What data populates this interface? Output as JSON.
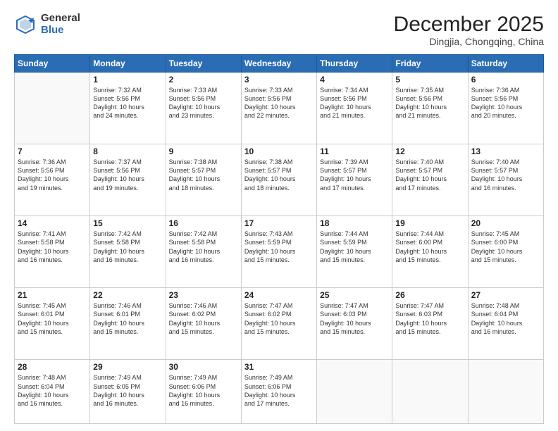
{
  "logo": {
    "general": "General",
    "blue": "Blue"
  },
  "header": {
    "month": "December 2025",
    "location": "Dingjia, Chongqing, China"
  },
  "weekdays": [
    "Sunday",
    "Monday",
    "Tuesday",
    "Wednesday",
    "Thursday",
    "Friday",
    "Saturday"
  ],
  "weeks": [
    [
      {
        "day": "",
        "info": ""
      },
      {
        "day": "1",
        "info": "Sunrise: 7:32 AM\nSunset: 5:56 PM\nDaylight: 10 hours\nand 24 minutes."
      },
      {
        "day": "2",
        "info": "Sunrise: 7:33 AM\nSunset: 5:56 PM\nDaylight: 10 hours\nand 23 minutes."
      },
      {
        "day": "3",
        "info": "Sunrise: 7:33 AM\nSunset: 5:56 PM\nDaylight: 10 hours\nand 22 minutes."
      },
      {
        "day": "4",
        "info": "Sunrise: 7:34 AM\nSunset: 5:56 PM\nDaylight: 10 hours\nand 21 minutes."
      },
      {
        "day": "5",
        "info": "Sunrise: 7:35 AM\nSunset: 5:56 PM\nDaylight: 10 hours\nand 21 minutes."
      },
      {
        "day": "6",
        "info": "Sunrise: 7:36 AM\nSunset: 5:56 PM\nDaylight: 10 hours\nand 20 minutes."
      }
    ],
    [
      {
        "day": "7",
        "info": "Sunrise: 7:36 AM\nSunset: 5:56 PM\nDaylight: 10 hours\nand 19 minutes."
      },
      {
        "day": "8",
        "info": "Sunrise: 7:37 AM\nSunset: 5:56 PM\nDaylight: 10 hours\nand 19 minutes."
      },
      {
        "day": "9",
        "info": "Sunrise: 7:38 AM\nSunset: 5:57 PM\nDaylight: 10 hours\nand 18 minutes."
      },
      {
        "day": "10",
        "info": "Sunrise: 7:38 AM\nSunset: 5:57 PM\nDaylight: 10 hours\nand 18 minutes."
      },
      {
        "day": "11",
        "info": "Sunrise: 7:39 AM\nSunset: 5:57 PM\nDaylight: 10 hours\nand 17 minutes."
      },
      {
        "day": "12",
        "info": "Sunrise: 7:40 AM\nSunset: 5:57 PM\nDaylight: 10 hours\nand 17 minutes."
      },
      {
        "day": "13",
        "info": "Sunrise: 7:40 AM\nSunset: 5:57 PM\nDaylight: 10 hours\nand 16 minutes."
      }
    ],
    [
      {
        "day": "14",
        "info": "Sunrise: 7:41 AM\nSunset: 5:58 PM\nDaylight: 10 hours\nand 16 minutes."
      },
      {
        "day": "15",
        "info": "Sunrise: 7:42 AM\nSunset: 5:58 PM\nDaylight: 10 hours\nand 16 minutes."
      },
      {
        "day": "16",
        "info": "Sunrise: 7:42 AM\nSunset: 5:58 PM\nDaylight: 10 hours\nand 16 minutes."
      },
      {
        "day": "17",
        "info": "Sunrise: 7:43 AM\nSunset: 5:59 PM\nDaylight: 10 hours\nand 15 minutes."
      },
      {
        "day": "18",
        "info": "Sunrise: 7:44 AM\nSunset: 5:59 PM\nDaylight: 10 hours\nand 15 minutes."
      },
      {
        "day": "19",
        "info": "Sunrise: 7:44 AM\nSunset: 6:00 PM\nDaylight: 10 hours\nand 15 minutes."
      },
      {
        "day": "20",
        "info": "Sunrise: 7:45 AM\nSunset: 6:00 PM\nDaylight: 10 hours\nand 15 minutes."
      }
    ],
    [
      {
        "day": "21",
        "info": "Sunrise: 7:45 AM\nSunset: 6:01 PM\nDaylight: 10 hours\nand 15 minutes."
      },
      {
        "day": "22",
        "info": "Sunrise: 7:46 AM\nSunset: 6:01 PM\nDaylight: 10 hours\nand 15 minutes."
      },
      {
        "day": "23",
        "info": "Sunrise: 7:46 AM\nSunset: 6:02 PM\nDaylight: 10 hours\nand 15 minutes."
      },
      {
        "day": "24",
        "info": "Sunrise: 7:47 AM\nSunset: 6:02 PM\nDaylight: 10 hours\nand 15 minutes."
      },
      {
        "day": "25",
        "info": "Sunrise: 7:47 AM\nSunset: 6:03 PM\nDaylight: 10 hours\nand 15 minutes."
      },
      {
        "day": "26",
        "info": "Sunrise: 7:47 AM\nSunset: 6:03 PM\nDaylight: 10 hours\nand 15 minutes."
      },
      {
        "day": "27",
        "info": "Sunrise: 7:48 AM\nSunset: 6:04 PM\nDaylight: 10 hours\nand 16 minutes."
      }
    ],
    [
      {
        "day": "28",
        "info": "Sunrise: 7:48 AM\nSunset: 6:04 PM\nDaylight: 10 hours\nand 16 minutes."
      },
      {
        "day": "29",
        "info": "Sunrise: 7:49 AM\nSunset: 6:05 PM\nDaylight: 10 hours\nand 16 minutes."
      },
      {
        "day": "30",
        "info": "Sunrise: 7:49 AM\nSunset: 6:06 PM\nDaylight: 10 hours\nand 16 minutes."
      },
      {
        "day": "31",
        "info": "Sunrise: 7:49 AM\nSunset: 6:06 PM\nDaylight: 10 hours\nand 17 minutes."
      },
      {
        "day": "",
        "info": ""
      },
      {
        "day": "",
        "info": ""
      },
      {
        "day": "",
        "info": ""
      }
    ]
  ]
}
